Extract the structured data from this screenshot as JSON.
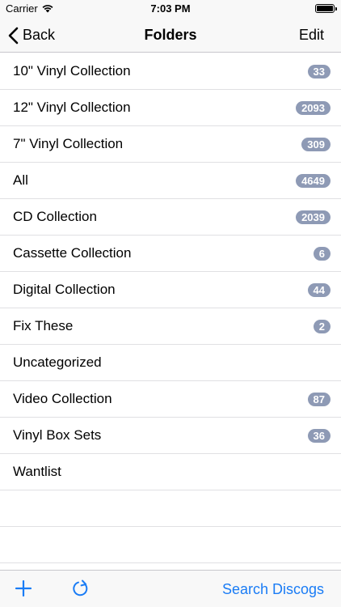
{
  "status_bar": {
    "carrier": "Carrier",
    "time": "7:03 PM"
  },
  "nav": {
    "back_label": "Back",
    "title": "Folders",
    "edit_label": "Edit"
  },
  "folders": [
    {
      "name": "10\" Vinyl Collection",
      "count": "33"
    },
    {
      "name": "12\" Vinyl Collection",
      "count": "2093"
    },
    {
      "name": "7\" Vinyl Collection",
      "count": "309"
    },
    {
      "name": "All",
      "count": "4649"
    },
    {
      "name": "CD Collection",
      "count": "2039"
    },
    {
      "name": "Cassette Collection",
      "count": "6"
    },
    {
      "name": "Digital Collection",
      "count": "44"
    },
    {
      "name": "Fix These",
      "count": "2"
    },
    {
      "name": "Uncategorized",
      "count": ""
    },
    {
      "name": "Video Collection",
      "count": "87"
    },
    {
      "name": "Vinyl Box Sets",
      "count": "36"
    },
    {
      "name": "Wantlist",
      "count": ""
    }
  ],
  "toolbar": {
    "add_icon": "plus-icon",
    "refresh_icon": "refresh-icon",
    "search_label": "Search Discogs"
  },
  "colors": {
    "accent": "#1a7cf5",
    "badge": "#8e9ab5",
    "bar_background": "#f8f8f8",
    "separator": "#e0e0e3"
  }
}
